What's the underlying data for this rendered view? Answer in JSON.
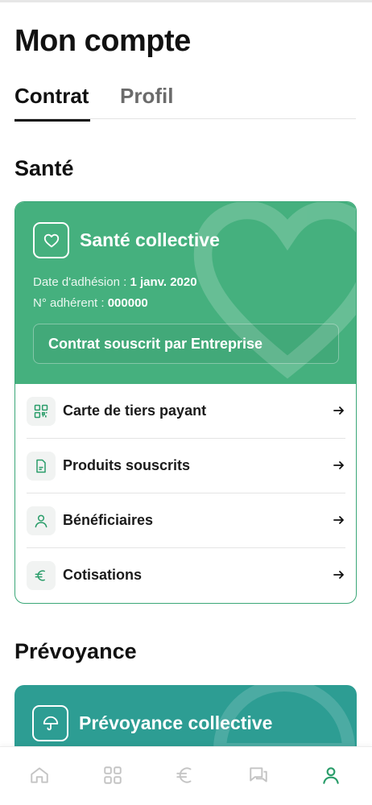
{
  "header": {
    "title": "Mon compte"
  },
  "tabs": [
    {
      "label": "Contrat",
      "active": true
    },
    {
      "label": "Profil",
      "active": false
    }
  ],
  "sante": {
    "section_title": "Santé",
    "card": {
      "icon": "heart-icon",
      "name": "Santé collective",
      "date_label": "Date d'adhésion : ",
      "date_value": "1 janv. 2020",
      "member_label": "N° adhérent : ",
      "member_value": "000000",
      "contract_button": "Contrat souscrit par Entreprise",
      "accent_color": "#45b07e"
    },
    "menu": [
      {
        "label": "Carte de tiers payant",
        "icon": "qr-code-icon"
      },
      {
        "label": "Produits souscrits",
        "icon": "document-icon"
      },
      {
        "label": "Bénéficiaires",
        "icon": "person-icon"
      },
      {
        "label": "Cotisations",
        "icon": "euro-icon"
      }
    ]
  },
  "prevoyance": {
    "section_title": "Prévoyance",
    "card": {
      "icon": "umbrella-icon",
      "name": "Prévoyance collective",
      "accent_color": "#2d9d93"
    }
  },
  "bottom_nav": [
    {
      "icon": "home-icon",
      "active": false
    },
    {
      "icon": "grid-icon",
      "active": false
    },
    {
      "icon": "euro-icon",
      "active": false
    },
    {
      "icon": "chat-icon",
      "active": false
    },
    {
      "icon": "profile-icon",
      "active": true
    }
  ],
  "colors": {
    "active": "#2a9d6a",
    "inactive": "#c4c4c4"
  }
}
